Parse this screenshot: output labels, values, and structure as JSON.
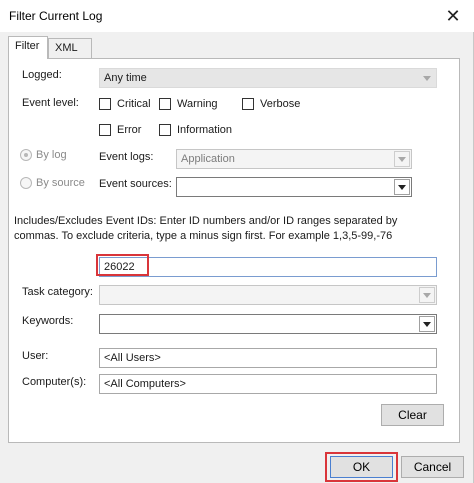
{
  "window": {
    "title": "Filter Current Log",
    "close_glyph": "✕"
  },
  "tabs": [
    {
      "label": "Filter"
    },
    {
      "label": "XML"
    }
  ],
  "logged": {
    "label": "Logged:",
    "value": "Any time"
  },
  "event_level": {
    "label": "Event level:",
    "options": [
      "Critical",
      "Warning",
      "Verbose",
      "Error",
      "Information"
    ]
  },
  "source_mode": {
    "by_log_label": "By log",
    "by_source_label": "By source",
    "event_logs_label": "Event logs:",
    "event_logs_value": "Application",
    "event_sources_label": "Event sources:",
    "event_sources_value": ""
  },
  "event_ids": {
    "description": "Includes/Excludes Event IDs: Enter ID numbers and/or ID ranges separated by commas. To exclude criteria, type a minus sign first. For example 1,3,5-99,-76",
    "value": "26022"
  },
  "task_category": {
    "label": "Task category:",
    "value": ""
  },
  "keywords": {
    "label": "Keywords:",
    "value": ""
  },
  "user": {
    "label": "User:",
    "value": "<All Users>"
  },
  "computer": {
    "label": "Computer(s):",
    "value": "<All Computers>"
  },
  "buttons": {
    "clear": "Clear",
    "ok": "OK",
    "cancel": "Cancel"
  },
  "colors": {
    "highlight": "#d9353a",
    "window_bg": "#f0f0f0"
  }
}
